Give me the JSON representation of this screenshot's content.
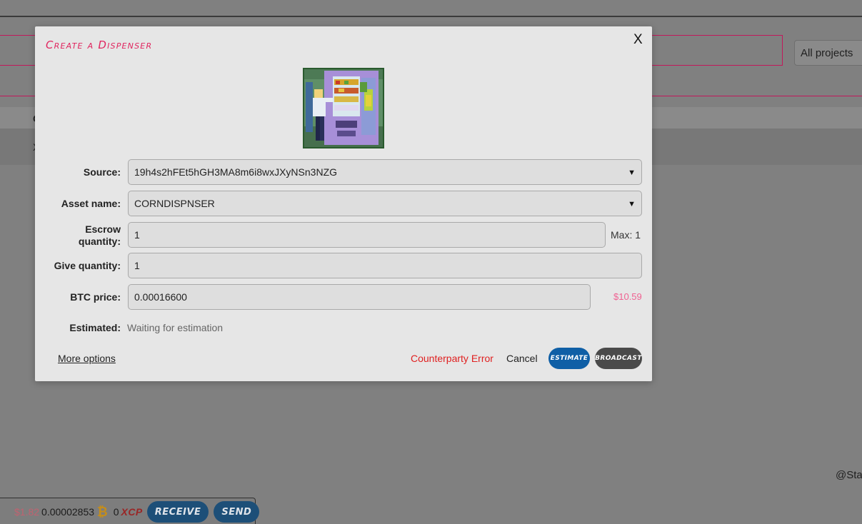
{
  "background": {
    "project_filter": "All projects",
    "handle_fragment": "@Sta",
    "column_fragment": "C",
    "row_fragment": "X"
  },
  "wallet_bar": {
    "usd_value": "$1.82",
    "btc_balance": "0.00002853",
    "btc_icon": "bitcoin-icon",
    "xcp_balance": "0",
    "xcp_label": "XCP",
    "receive_label": "Receive",
    "send_label": "Send"
  },
  "modal": {
    "title": "Create a Dispenser",
    "close_label": "X",
    "asset_image": "vending-machine-pixel-art",
    "fields": {
      "source": {
        "label": "Source:",
        "value": "19h4s2hFEt5hGH3MA8m6i8wxJXyNSn3NZG"
      },
      "asset_name": {
        "label": "Asset name:",
        "value": "CORNDISPNSER"
      },
      "escrow_quantity": {
        "label_line1": "Escrow",
        "label_line2": "quantity:",
        "value": "1",
        "max_text": "Max: 1"
      },
      "give_quantity": {
        "label": "Give quantity:",
        "value": "1"
      },
      "btc_price": {
        "label": "BTC price:",
        "value": "0.00016600",
        "usd_value": "$10.59"
      },
      "estimated": {
        "label": "Estimated:",
        "value": "Waiting for estimation"
      }
    },
    "footer": {
      "more_options": "More options",
      "error_text": "Counterparty Error",
      "cancel_label": "Cancel",
      "estimate_label": "Estimate",
      "broadcast_label": "Broadcast"
    }
  },
  "colors": {
    "overlay": "#808080",
    "modal_bg": "#e6e6e6",
    "title_accent": "#e0245e",
    "estimate_button": "#0f5fa6",
    "broadcast_button": "#4a4a4a",
    "error": "#e02020",
    "usd_price": "#f06292"
  }
}
